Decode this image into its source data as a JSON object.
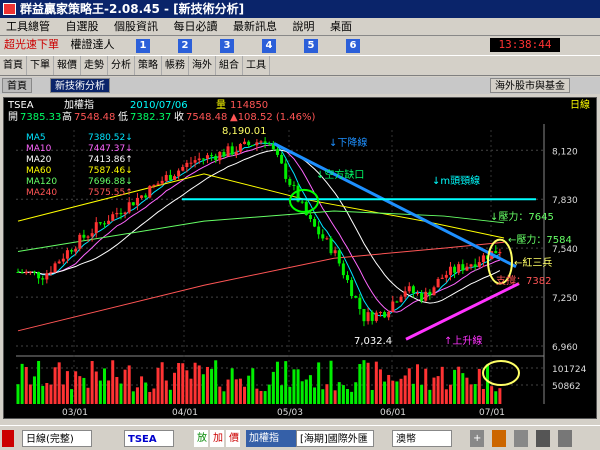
{
  "window": {
    "title": "群益贏家策略王-2.08.45 - [新技術分析]"
  },
  "menu": [
    "工具總管",
    "自選股",
    "個股資訊",
    "每日必讀",
    "最新訊息",
    "說明",
    "桌面"
  ],
  "toolrow": {
    "label1": "超光速下單",
    "label2": "權證達人",
    "numbers": [
      "1",
      "2",
      "3",
      "4",
      "5",
      "6"
    ],
    "clock": "13:38:44"
  },
  "toolbar": [
    "首頁",
    "下單",
    "報價",
    "走勢",
    "分析",
    "策略",
    "帳務",
    "海外",
    "組合",
    "工具"
  ],
  "tabs": {
    "home": "首頁",
    "active": "新技術分析",
    "foreign": "海外股市與基金"
  },
  "header": {
    "symbol": "TSEA",
    "index_name": "加權指",
    "date": "2010/07/06",
    "vol_label": "量",
    "vol_value": "114850",
    "period": "日線",
    "open_label": "開",
    "open": "7385.33",
    "high_label": "高",
    "high": "7548.48",
    "low_label": "低",
    "low": "7382.37",
    "close_label": "收",
    "close": "7548.48",
    "change": "▲108.52 (1.46%)"
  },
  "ma_legend": [
    {
      "name": "MA5",
      "value": "7380.52↓",
      "color": "#00e5ff"
    },
    {
      "name": "MA10",
      "value": "7447.37↓",
      "color": "#ff66ff"
    },
    {
      "name": "MA20",
      "value": "7413.86↑",
      "color": "#ffffff"
    },
    {
      "name": "MA60",
      "value": "7587.46↓",
      "color": "#ffff00"
    },
    {
      "name": "MA120",
      "value": "7696.88↓",
      "color": "#66ff66"
    },
    {
      "name": "MA240",
      "value": "7575.55↑",
      "color": "#ff5555"
    }
  ],
  "annotations": {
    "high_mark": "8,190.01",
    "low_mark": "7,032.4",
    "down_line": "↓下降線",
    "gap": "↓空方缺口",
    "neckline": "↓m頭頸線",
    "res1": "↓壓力：7645",
    "res2": "←壓力：7584",
    "three": "←紅三兵",
    "support": "支撐：7382",
    "up_line": "↑上升線"
  },
  "axis": {
    "y_labels": [
      "8,120",
      "7,830",
      "7,540",
      "7,250",
      "6,960"
    ],
    "vol_labels": [
      "101724",
      "50862"
    ],
    "x_labels": [
      "03/01",
      "04/01",
      "05/03",
      "06/01",
      "07/01"
    ]
  },
  "bottom": {
    "period_select": "日線(完整)",
    "symbol": "TSEA",
    "btn_add": "放",
    "btn_draw": "加",
    "btn_del": "價",
    "name": "加權指",
    "market": "[海期]國際外匯",
    "currency": "澳幣"
  },
  "chart_data": {
    "type": "candlestick",
    "title": "",
    "series_ma": [
      "MA5",
      "MA10",
      "MA20",
      "MA60",
      "MA120",
      "MA240"
    ],
    "ylim": [
      6960,
      8240
    ]
  }
}
